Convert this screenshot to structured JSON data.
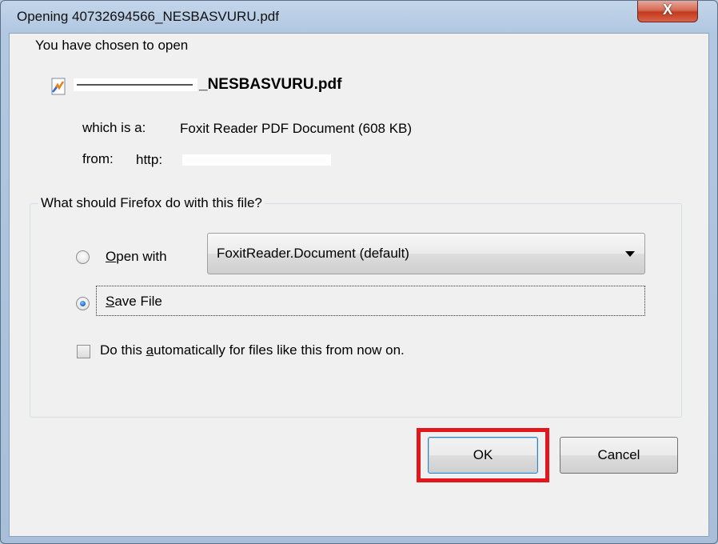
{
  "window": {
    "title": "Opening 40732694566_NESBASVURU.pdf",
    "close_symbol": "X"
  },
  "dialog": {
    "intro": "You have chosen to open",
    "file": {
      "name_visible": "_NESBASVURU.pdf",
      "icon": "pdf-file-icon"
    },
    "which_is_label": "which is a:",
    "which_is_value": "Foxit Reader PDF Document (608 KB)",
    "from_label": "from:",
    "from_value": "http:"
  },
  "group": {
    "legend": "What should Firefox do with this file?",
    "open_with": {
      "mnemonic": "O",
      "label_rest": "pen with",
      "checked": false
    },
    "app_select": {
      "value": "FoxitReader.Document (default)"
    },
    "save_file": {
      "mnemonic": "S",
      "label_rest": "ave File",
      "checked": true
    },
    "auto": {
      "pre": "Do this ",
      "mnemonic": "a",
      "post": "utomatically for files like this from now on.",
      "checked": false
    }
  },
  "buttons": {
    "ok": "OK",
    "cancel": "Cancel"
  },
  "colors": {
    "highlight": "#e3161b",
    "title_bar": "#b2c8e1",
    "close_button": "#c23a1e"
  }
}
